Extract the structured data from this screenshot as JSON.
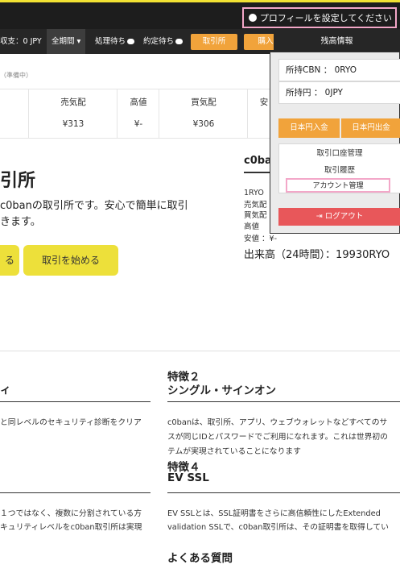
{
  "header": {
    "profile_label": "プロフィールを設定してください"
  },
  "nav": {
    "balance": "収支：0 JPY",
    "period": "全期間",
    "processing": "処理待ち",
    "pending": "約定待ち",
    "exchange_btn": "取引所",
    "buy_btn": "購入",
    "balance_info_title": "残高情報"
  },
  "ticker": {
    "status": "（準備中）",
    "cols": [
      {
        "header": "売気配",
        "value": "¥313"
      },
      {
        "header": "高値",
        "value": "¥-"
      },
      {
        "header": "買気配",
        "value": "¥306"
      },
      {
        "header": "安"
      }
    ]
  },
  "hero": {
    "title": "引所",
    "line1": "c0banの取引所です。安心で簡単に取引",
    "line2": "きます。",
    "btn_left": "る",
    "btn_start": "取引を始める"
  },
  "side_info": {
    "title": "c0ba",
    "rows": [
      "1RYO",
      "売気配",
      "買気配",
      "高値",
      "安値 ：¥-"
    ],
    "volume": "出来高（24時間）：19930RYO"
  },
  "dropdown": {
    "cbn": "所持CBN ： 0RYO",
    "jpy": "所持円 ： 0JPY",
    "deposit": "日本円入金",
    "withdraw": "日本円出金",
    "menu": [
      "取引口座管理",
      "取引履歴",
      "アカウント管理"
    ],
    "logout": "ログアウト"
  },
  "features": {
    "f1_title": "ィ",
    "f1_text": "と同レベルのセキュリティ診断をクリア",
    "f2_title_1": "特徴２",
    "f2_title_2": "シングル・サインオン",
    "f2_text": [
      "c0banは、取引所、アプリ、ウェブウォレットなどすべてのサ",
      "スが同じIDとパスワードでご利用になれます。これは世界初の",
      "テムが実現されていることになります"
    ],
    "f4_title_1": "特徴４",
    "f4_title_2": "EV SSL",
    "f3_text": [
      "１つではなく、複数に分割されている方",
      "キュリティレベルをc0ban取引所は実現"
    ],
    "f4_text": [
      "EV SSLとは、SSL証明書をさらに高信頼性にしたExtended",
      "validation SSLで、c0ban取引所は、その証明書を取得してい"
    ],
    "faq": "よくある質問"
  },
  "colors": {
    "accent_yellow": "#ede03a",
    "orange": "#f1a33b",
    "logout_red": "#e8575a",
    "highlight_pink": "#f3a7c8"
  }
}
